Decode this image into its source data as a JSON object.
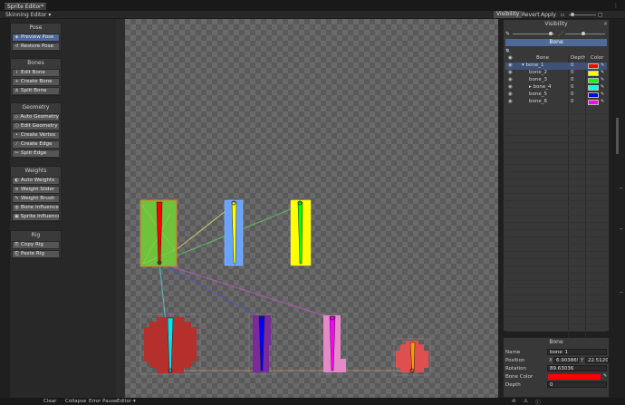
{
  "window": {
    "tab_title": "Sprite Editor*",
    "tab_menu_glyph": "⋮",
    "mode_dropdown": "Skinning Editor ▾",
    "visibility_button": "Visibility",
    "revert_button": "Revert",
    "apply_button": "Apply"
  },
  "left_panel": {
    "groups": [
      {
        "title": "Pose",
        "items": [
          {
            "label": "Preview Pose",
            "icon": "pose-icon",
            "active": true
          },
          {
            "label": "Restore Pose",
            "icon": "restore-icon",
            "active": false
          }
        ]
      },
      {
        "title": "Bones",
        "items": [
          {
            "label": "Edit Bone",
            "icon": "bone-edit-icon",
            "active": false
          },
          {
            "label": "Create Bone",
            "icon": "bone-create-icon",
            "active": false
          },
          {
            "label": "Split Bone",
            "icon": "bone-split-icon",
            "active": false
          }
        ]
      },
      {
        "title": "Geometry",
        "items": [
          {
            "label": "Auto Geometry",
            "icon": "auto-geometry-icon",
            "active": false
          },
          {
            "label": "Edit Geometry",
            "icon": "edit-geometry-icon",
            "active": false
          },
          {
            "label": "Create Vertex",
            "icon": "vertex-icon",
            "active": false
          },
          {
            "label": "Create Edge",
            "icon": "edge-icon",
            "active": false
          },
          {
            "label": "Split Edge",
            "icon": "split-edge-icon",
            "active": false
          }
        ]
      },
      {
        "title": "Weights",
        "items": [
          {
            "label": "Auto Weights",
            "icon": "auto-weights-icon",
            "active": false
          },
          {
            "label": "Weight Slider",
            "icon": "weight-slider-icon",
            "active": false
          },
          {
            "label": "Weight Brush",
            "icon": "weight-brush-icon",
            "active": false
          },
          {
            "label": "Bone Influence",
            "icon": "bone-influence-icon",
            "active": false
          },
          {
            "label": "Sprite Influence",
            "icon": "sprite-influence-icon",
            "active": false
          }
        ]
      },
      {
        "title": "Rig",
        "items": [
          {
            "label": "Copy Rig",
            "icon": "copy-rig-icon",
            "active": false
          },
          {
            "label": "Paste Rig",
            "icon": "paste-rig-icon",
            "active": false
          }
        ]
      }
    ]
  },
  "visibility_panel": {
    "title": "Visibility",
    "close_glyph": "×",
    "tab_label": "Bone",
    "search_glyph": "🔍",
    "headers": {
      "bone": "Bone",
      "depth": "Depth",
      "color": "Color"
    },
    "bones": [
      {
        "name": "bone_1",
        "depth": "0",
        "color": "#ff0000",
        "indent": 0,
        "expander": "▾",
        "selected": true
      },
      {
        "name": "bone_2",
        "depth": "0",
        "color": "#ffff00",
        "indent": 1,
        "expander": "",
        "selected": false
      },
      {
        "name": "bone_3",
        "depth": "0",
        "color": "#00ff00",
        "indent": 1,
        "expander": "",
        "selected": false
      },
      {
        "name": "bone_4",
        "depth": "0",
        "color": "#00ffff",
        "indent": 1,
        "expander": "▸",
        "selected": false
      },
      {
        "name": "bone_5",
        "depth": "0",
        "color": "#0000ff",
        "indent": 1,
        "expander": "",
        "selected": false
      },
      {
        "name": "bone_6",
        "depth": "0",
        "color": "#ff00ff",
        "indent": 1,
        "expander": "",
        "selected": false
      }
    ]
  },
  "inspector": {
    "title": "Bone",
    "name_label": "Name",
    "name_value": "bone_1",
    "position_label": "Position",
    "position_x_label": "X",
    "position_x": "6.903865",
    "position_y_label": "Y",
    "position_y": "22.51204",
    "rotation_label": "Rotation",
    "rotation_value": "89.63036",
    "color_label": "Bone Color",
    "color_value": "#ff0000",
    "depth_label": "Depth",
    "depth_value": "0"
  },
  "status_bar": {
    "clear": "Clear",
    "collapse": "Collapse",
    "error_pause": "Error Pause",
    "editor": "Editor ▾"
  },
  "colors": {
    "accent": "#4d6a98",
    "panel_bg": "#383838",
    "dark_bg": "#191919"
  }
}
